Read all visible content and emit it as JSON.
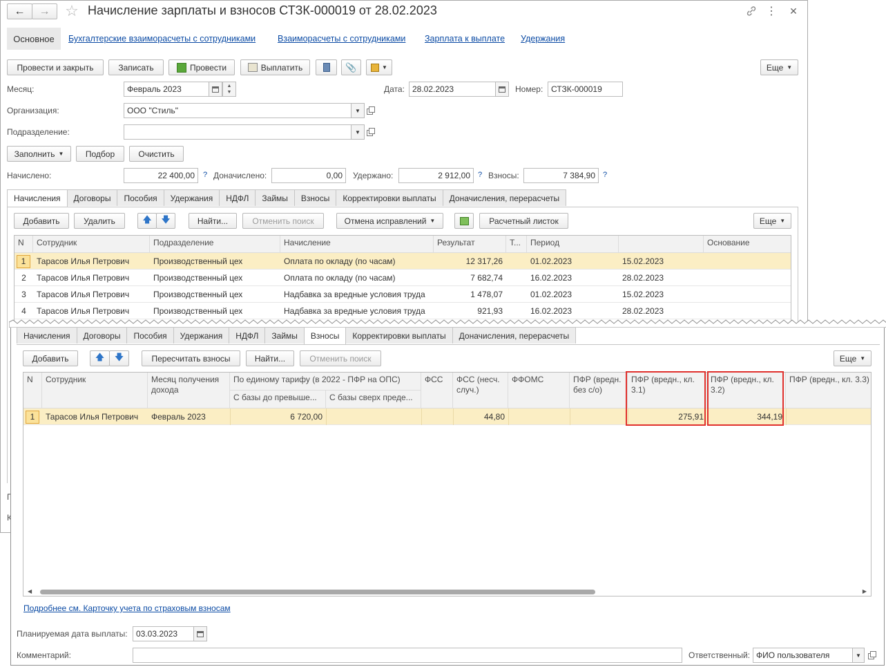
{
  "window": {
    "title": "Начисление зарплаты и взносов СТЗК-000019 от 28.02.2023"
  },
  "nav_tabs": [
    "Основное",
    "Бухгалтерские взаиморасчеты с сотрудниками",
    "Взаиморасчеты с сотрудниками",
    "Зарплата к выплате",
    "Удержания"
  ],
  "toolbar": {
    "post_close": "Провести и закрыть",
    "save": "Записать",
    "post": "Провести",
    "pay": "Выплатить",
    "more": "Еще"
  },
  "form": {
    "month_label": "Месяц:",
    "month_value": "Февраль 2023",
    "date_label": "Дата:",
    "date_value": "28.02.2023",
    "number_label": "Номер:",
    "number_value": "СТЗК-000019",
    "org_label": "Организация:",
    "org_value": "ООО \"Стиль\"",
    "dept_label": "Подразделение:",
    "dept_value": "",
    "fill": "Заполнить",
    "pick": "Подбор",
    "clear": "Очистить",
    "accrued_label": "Начислено:",
    "accrued_value": "22 400,00",
    "extra_label": "Доначислено:",
    "extra_value": "0,00",
    "withheld_label": "Удержано:",
    "withheld_value": "2 912,00",
    "contrib_label": "Взносы:",
    "contrib_value": "7 384,90",
    "help": "?"
  },
  "back_tabs": [
    "Начисления",
    "Договоры",
    "Пособия",
    "Удержания",
    "НДФЛ",
    "Займы",
    "Взносы",
    "Корректировки выплаты",
    "Доначисления, перерасчеты"
  ],
  "back_toolbar": {
    "add": "Добавить",
    "delete": "Удалить",
    "find": "Найти...",
    "cancel_search": "Отменить поиск",
    "cancel_fix": "Отмена исправлений",
    "payslip": "Расчетный листок",
    "more": "Еще"
  },
  "back_table": {
    "headers": [
      "N",
      "Сотрудник",
      "Подразделение",
      "Начисление",
      "Результат",
      "Т...",
      "Период",
      "",
      "Основание"
    ],
    "rows": [
      [
        "1",
        "Тарасов Илья Петрович",
        "Производственный цех",
        "Оплата по окладу (по часам)",
        "12 317,26",
        "",
        "01.02.2023",
        "15.02.2023",
        ""
      ],
      [
        "2",
        "Тарасов Илья Петрович",
        "Производственный цех",
        "Оплата по окладу (по часам)",
        "7 682,74",
        "",
        "16.02.2023",
        "28.02.2023",
        ""
      ],
      [
        "3",
        "Тарасов Илья Петрович",
        "Производственный цех",
        "Надбавка за вредные условия труда",
        "1 478,07",
        "",
        "01.02.2023",
        "15.02.2023",
        ""
      ],
      [
        "4",
        "Тарасов Илья Петрович",
        "Производственный цех",
        "Надбавка за вредные условия труда",
        "921,93",
        "",
        "16.02.2023",
        "28.02.2023",
        ""
      ]
    ]
  },
  "front_tabs": [
    "Начисления",
    "Договоры",
    "Пособия",
    "Удержания",
    "НДФЛ",
    "Займы",
    "Взносы",
    "Корректировки выплаты",
    "Доначисления, перерасчеты"
  ],
  "front_toolbar": {
    "add": "Добавить",
    "recalc": "Пересчитать взносы",
    "find": "Найти...",
    "cancel_search": "Отменить поиск",
    "more": "Еще"
  },
  "front_table": {
    "h_n": "N",
    "h_emp": "Сотрудник",
    "h_month": "Месяц получения дохода",
    "h_single": "По единому тарифу (в 2022 - ПФР на ОПС)",
    "h_single_a": "С базы до превыше...",
    "h_single_b": "С базы сверх преде...",
    "h_fss": "ФСС",
    "h_fss_ns": "ФСС (несч. случ.)",
    "h_ffoms": "ФФОМС",
    "h_pfr_no": "ПФР (вредн. без с/о)",
    "h_pfr31": "ПФР (вредн., кл. 3.1)",
    "h_pfr32": "ПФР (вредн., кл. 3.2)",
    "h_pfr33": "ПФР (вредн., кл. 3.3)",
    "row": {
      "n": "1",
      "emp": "Тарасов Илья Петрович",
      "month": "Февраль 2023",
      "single_a": "6 720,00",
      "single_b": "",
      "fss": "",
      "fss_ns": "44,80",
      "ffoms": "",
      "pfr_no": "",
      "pfr31": "275,91",
      "pfr32": "344,19",
      "pfr33": ""
    }
  },
  "footer": {
    "link": "Подробнее см. Карточку учета по страховым взносам",
    "plan_date_label": "Планируемая дата выплаты:",
    "plan_date_value": "03.03.2023",
    "comment_label": "Комментарий:",
    "comment_value": "",
    "resp_label": "Ответственный:",
    "resp_value": "ФИО пользователя"
  },
  "back_footer_fragments": [
    "П",
    "К"
  ]
}
